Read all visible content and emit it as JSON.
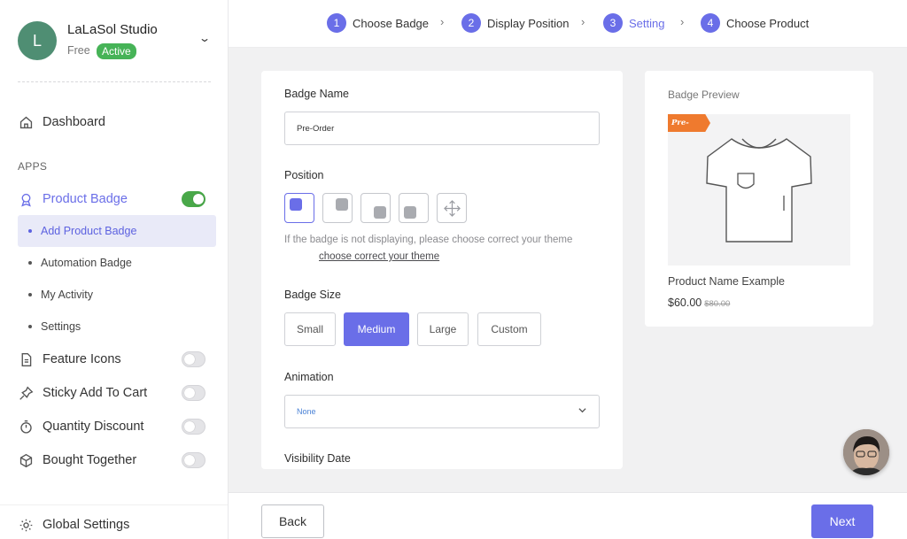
{
  "store": {
    "initial": "L",
    "name": "LaLaSol Studio",
    "plan": "Free",
    "status": "Active"
  },
  "sidebar": {
    "dashboard": "Dashboard",
    "apps_label": "APPS",
    "product_badge": "Product Badge",
    "sub_items": [
      "Add Product Badge",
      "Automation Badge",
      "My Activity",
      "Settings"
    ],
    "apps": [
      "Feature Icons",
      "Sticky Add To Cart",
      "Quantity Discount",
      "Bought Together"
    ],
    "global_settings": "Global Settings"
  },
  "stepper": {
    "steps": [
      {
        "num": "1",
        "label": "Choose Badge"
      },
      {
        "num": "2",
        "label": "Display Position"
      },
      {
        "num": "3",
        "label": "Setting"
      },
      {
        "num": "4",
        "label": "Choose Product"
      }
    ],
    "separator": "›",
    "current": "Setting"
  },
  "form": {
    "badge_name_label": "Badge Name",
    "badge_name_value": "Pre-Order",
    "position_label": "Position",
    "position_selected": "top-left",
    "help_text": "If the badge is not displaying, please choose correct your theme",
    "help_link": "choose correct your theme",
    "badge_size_label": "Badge Size",
    "sizes": [
      "Small",
      "Medium",
      "Large",
      "Custom"
    ],
    "size_selected": "Medium",
    "animation_label": "Animation",
    "animation_value": "None",
    "visibility_label": "Visibility Date"
  },
  "preview": {
    "title": "Badge Preview",
    "tag_text": "Pre-Order",
    "product_name": "Product Name Example",
    "price": "$60.00",
    "old_price": "$80.00"
  },
  "footer": {
    "back_label": "Back",
    "next_label": "Next"
  },
  "colors": {
    "accent": "#6a6ee8",
    "active_green": "#46b357",
    "tag_orange": "#ef7a2e"
  }
}
